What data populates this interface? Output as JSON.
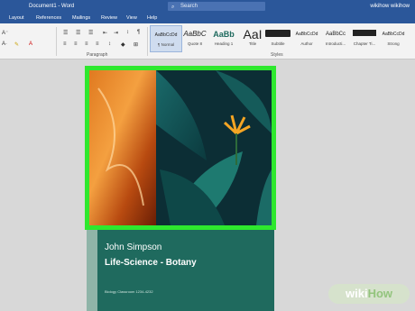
{
  "titlebar": {
    "title": "Document1  -  Word",
    "search_placeholder": "Search",
    "user": "wikihow wikihow"
  },
  "tabs": [
    "Layout",
    "References",
    "Mailings",
    "Review",
    "View",
    "Help"
  ],
  "ribbon": {
    "paragraph_label": "Paragraph",
    "styles_label": "Styles",
    "styles": [
      {
        "sample": "AaBbCcDd",
        "name": "¶ Normal",
        "active": true
      },
      {
        "sample": "AaBbC",
        "name": "Quote 8"
      },
      {
        "sample": "AaBb",
        "name": "Heading 1"
      },
      {
        "sample": "AaI",
        "name": "Title"
      },
      {
        "sample": "AaBbCcDd",
        "name": "Subtitle"
      },
      {
        "sample": "AaBbCcDd",
        "name": "Author"
      },
      {
        "sample": "AaBbCc",
        "name": "Introducti..."
      },
      {
        "sample": "AaBbCcDd",
        "name": "Chapter Ti..."
      },
      {
        "sample": "AaBbCcDd",
        "name": "Strong"
      }
    ]
  },
  "cover": {
    "author": "John Simpson",
    "subject": "Life-Science - Botany",
    "meta": "Biology Classroom 1234-4232"
  },
  "watermark": {
    "wiki": "wiki",
    "how": "How"
  },
  "colors": {
    "accent": "#2b579a",
    "highlight": "#2ee82e",
    "cover": "#1f6a5e"
  }
}
